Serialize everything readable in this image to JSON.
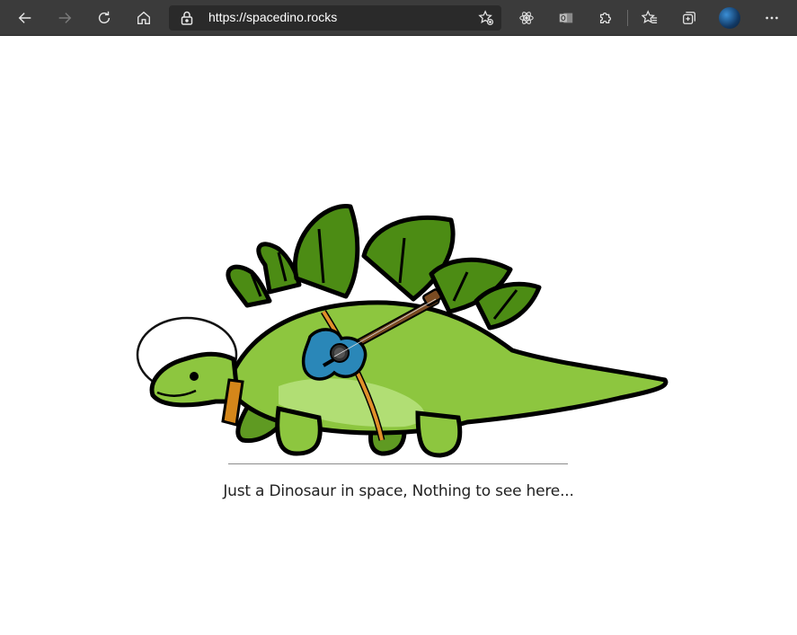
{
  "browser": {
    "url_scheme": "https://",
    "url_host": "spacedino.rocks"
  },
  "page": {
    "tagline": "Just a Dinosaur in space, Nothing to see here..."
  },
  "icons": {
    "back": "arrow-left-icon",
    "forward": "arrow-right-icon",
    "refresh": "refresh-icon",
    "home": "home-icon",
    "lock": "lock-icon",
    "favorite_add": "star-add-icon",
    "extension_react": "react-icon",
    "extension_outlook": "outlook-icon",
    "extensions": "puzzle-icon",
    "favorites": "favorites-icon",
    "collections": "collections-icon",
    "profile": "avatar",
    "menu": "more-icon"
  }
}
